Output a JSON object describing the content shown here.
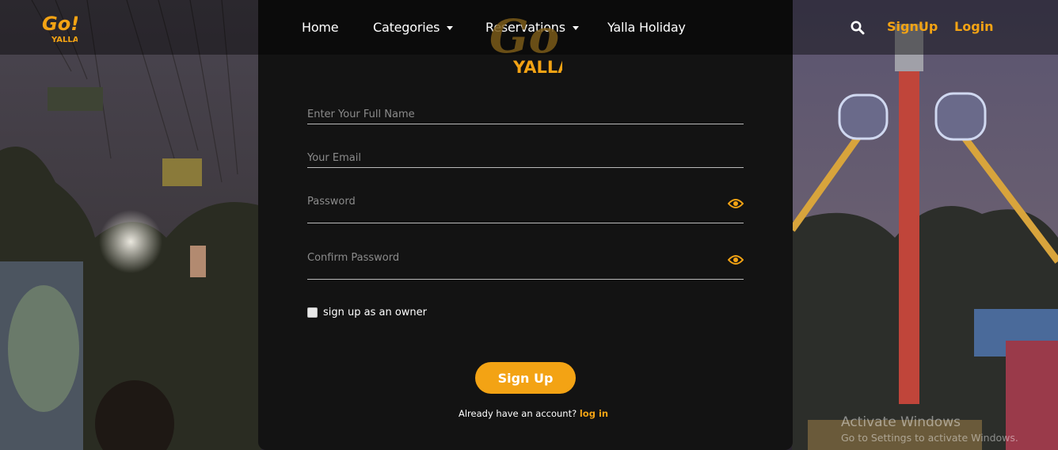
{
  "brand": {
    "logo_text_top": "Go!",
    "logo_text_bottom": "YALLA",
    "accent_color": "#f3a314"
  },
  "nav": {
    "items": [
      {
        "label": "Home",
        "has_dropdown": false
      },
      {
        "label": "Categories",
        "has_dropdown": true
      },
      {
        "label": "Reservations",
        "has_dropdown": true
      },
      {
        "label": "Yalla Holiday",
        "has_dropdown": false
      }
    ],
    "search_icon": "search-icon",
    "signup_label": "SignUp",
    "login_label": "Login"
  },
  "form": {
    "full_name": {
      "placeholder": "Enter Your Full Name",
      "value": ""
    },
    "email": {
      "placeholder": "Your Email",
      "value": ""
    },
    "password": {
      "placeholder": "Password",
      "value": "",
      "icon": "eye-icon"
    },
    "confirm_password": {
      "placeholder": "Confirm Password",
      "value": "",
      "icon": "eye-icon"
    },
    "owner_checkbox_label": "sign up as an owner",
    "owner_checked": false,
    "submit_label": "Sign Up",
    "have_account_text": "Already have an account?",
    "login_link": "log in"
  },
  "watermark": {
    "title": "Activate Windows",
    "subtitle": "Go to Settings to activate Windows."
  }
}
